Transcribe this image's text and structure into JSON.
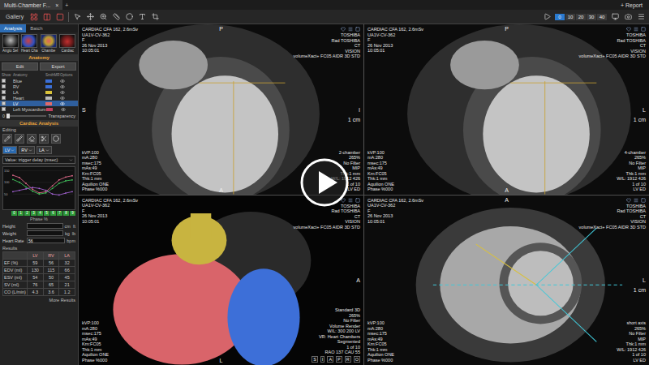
{
  "title_bar": {
    "tab": "Multi-Chamber F...",
    "close": "×",
    "add": "+",
    "report": "+ Report"
  },
  "toolbar": {
    "gallery": "Gallery",
    "frames": [
      {
        "label": "0",
        "selected": true
      },
      {
        "label": "10",
        "selected": false
      },
      {
        "label": "20",
        "selected": false
      },
      {
        "label": "30",
        "selected": false
      },
      {
        "label": "40",
        "selected": false
      }
    ]
  },
  "left_panel": {
    "tabs": [
      {
        "label": "Analysis",
        "selected": true
      },
      {
        "label": "Batch",
        "selected": false
      }
    ],
    "thumbnails": [
      {
        "label": "Angio Sel",
        "kind": "angio"
      },
      {
        "label": "Heart Cha",
        "kind": "heart"
      },
      {
        "label": "Chambe",
        "kind": "chamber"
      },
      {
        "label": "Cardiac",
        "kind": "cardiac"
      }
    ],
    "anatomy": {
      "title": "Anatomy",
      "buttons": [
        "Edit",
        "Export"
      ],
      "columns": [
        "Show",
        "Anatomy",
        "SmthMR",
        "Options"
      ],
      "rows": [
        {
          "name": "Blue",
          "show": true,
          "selected": false,
          "color": "#3b6fd6"
        },
        {
          "name": "RV",
          "show": true,
          "selected": false,
          "color": "#3b6fd6"
        },
        {
          "name": "LA",
          "show": true,
          "selected": false,
          "color": "#d9c23a"
        },
        {
          "name": "Heart",
          "show": true,
          "selected": false,
          "color": "#bbbbbb"
        },
        {
          "name": "LV",
          "show": true,
          "selected": true,
          "color": "#e06a6a"
        },
        {
          "name": "Left Myocardium",
          "show": true,
          "selected": false,
          "color": "#c04060"
        }
      ]
    },
    "transparency": {
      "value": "0",
      "label": "Transparency",
      "level": 0.03
    },
    "cardiac": {
      "title": "Cardiac Analysis",
      "editing": "Editing",
      "chambers": [
        {
          "label": "LV",
          "selected": true
        },
        {
          "label": "RV",
          "selected": false
        },
        {
          "label": "LA",
          "selected": false
        }
      ],
      "value_label": "Value: trigger delay (msec)",
      "chart": {
        "y_ticks": [
          "150",
          "100",
          "50"
        ],
        "series": [
          {
            "color": "#e06a8a",
            "values": [
              130,
              120,
              95,
              70,
              55,
              60,
              85,
              110,
              122,
              128
            ]
          },
          {
            "color": "#3fbf5a",
            "values": [
              112,
              100,
              80,
              62,
              50,
              55,
              74,
              95,
              106,
              110
            ]
          },
          {
            "color": "#a060d0",
            "values": [
              60,
              66,
              72,
              78,
              74,
              66,
              50,
              46,
              54,
              60
            ]
          }
        ],
        "phases": [
          "0",
          "1",
          "2",
          "3",
          "4",
          "5",
          "6",
          "7",
          "8",
          "9"
        ],
        "x_label": "Phase %"
      },
      "fields": [
        {
          "label": "Height",
          "value": "",
          "units": [
            "cm",
            "ft"
          ]
        },
        {
          "label": "Weight",
          "value": "",
          "units": [
            "kg",
            "lb"
          ]
        },
        {
          "label": "Heart Rate",
          "value": "56",
          "units": [
            "bpm"
          ]
        }
      ],
      "results": {
        "title": "Results",
        "columns": [
          "LV",
          "RV",
          "LA"
        ],
        "rows": [
          {
            "label": "EF (%)",
            "values": [
              "59",
              "56",
              "32"
            ]
          },
          {
            "label": "EDV (ml)",
            "values": [
              "130",
              "115",
              "66"
            ]
          },
          {
            "label": "ESV (ml)",
            "values": [
              "54",
              "50",
              "45"
            ]
          },
          {
            "label": "SV (ml)",
            "values": [
              "76",
              "65",
              "21"
            ]
          },
          {
            "label": "CO (L/min)",
            "values": [
              "4.3",
              "3.6",
              "1.2"
            ]
          }
        ],
        "more": "More Results"
      }
    }
  },
  "viewports": [
    {
      "kind": "two-chamber",
      "patient": [
        "CARDIAC CFA 162, 2.6mSv",
        "UA1V-CV-362",
        "F",
        "26 Nov 2013",
        "10:05:01"
      ],
      "vendor": [
        "TOSHIBA",
        "Rad TOSHIBA",
        "CT",
        "VISION",
        "volumeXact+ FC05 AIDR 3D STD"
      ],
      "tech": [
        "kVP:100",
        "mA:280",
        "msec:175",
        "mAs:49",
        "Krn:FC05",
        "Thk:1 mm",
        "Aquilion ONE",
        "Phase %000"
      ],
      "info": [
        "2-chamber",
        "265%",
        "No Filter",
        "MIP",
        "Thk:1 mm",
        "W/L: 1912 426",
        "1 of 10",
        "LV ED"
      ],
      "letters": [],
      "markers": [
        {
          "text": "P",
          "kind": "top"
        },
        {
          "text": "S",
          "kind": "left"
        },
        {
          "text": "I",
          "kind": "right"
        },
        {
          "text": "A",
          "kind": "bottom"
        },
        {
          "text": "1 cm",
          "kind": "scale"
        }
      ]
    },
    {
      "kind": "four-chamber",
      "patient": [
        "CARDIAC CFA 162, 2.6mSv",
        "UA1V-CV-362",
        "F",
        "26 Nov 2013",
        "10:05:01"
      ],
      "vendor": [
        "TOSHIBA",
        "Rad TOSHIBA",
        "CT",
        "VISION",
        "volumeXact+ FC05 AIDR 3D STD"
      ],
      "tech": [
        "kVP:100",
        "mA:280",
        "msec:175",
        "mAs:49",
        "Krn:FC05",
        "Thk:1 mm",
        "Aquilion ONE",
        "Phase %000"
      ],
      "info": [
        "4-chamber",
        "265%",
        "No Filter",
        "MIP",
        "Thk:1 mm",
        "W/L: 1912 426",
        "1 of 10",
        "LV ED"
      ],
      "letters": [],
      "markers": [
        {
          "text": "P",
          "kind": "top"
        },
        {
          "text": "L",
          "kind": "right"
        },
        {
          "text": "A",
          "kind": "bottom"
        },
        {
          "text": "1 cm",
          "kind": "scale"
        }
      ]
    },
    {
      "kind": "render",
      "patient": [
        "CARDIAC CFA 162, 2.6mSv",
        "UA1V-CV-362",
        "F",
        "26 Nov 2013",
        "10:05:01"
      ],
      "vendor": [
        "TOSHIBA",
        "Rad TOSHIBA",
        "CT",
        "VISION",
        "volumeXact+ FC05 AIDR 3D STD"
      ],
      "tech": [
        "kVP:100",
        "mA:280",
        "msec:175",
        "mAs:49",
        "Krn:FC05",
        "Thk:1 mm",
        "Aquilion ONE",
        "Phase %000"
      ],
      "info": [
        "Standard 3D",
        "265%",
        "No Filter",
        "Volume Render",
        "W/L: 300 200 LV",
        "VR: Heart Chambers",
        "Segmented",
        "1 of 10",
        "RAO 137  CAU 55"
      ],
      "letters": [
        "S",
        "I",
        "A",
        "P",
        "R",
        "O"
      ],
      "markers": [
        {
          "text": "A",
          "kind": "right"
        },
        {
          "text": "L",
          "kind": "bottom"
        }
      ]
    },
    {
      "kind": "short-axis",
      "patient": [
        "CARDIAC CFA 162, 2.6mSv",
        "UA1V-CV-362",
        "F",
        "26 Nov 2013",
        "10:05:01"
      ],
      "vendor": [
        "TOSHIBA",
        "Rad TOSHIBA",
        "CT",
        "VISION",
        "volumeXact+ FC05 AIDR 3D STD"
      ],
      "tech": [
        "kVP:100",
        "mA:280",
        "msec:175",
        "mAs:49",
        "Krn:FC05",
        "Thk:1 mm",
        "Aquilion ONE",
        "Phase %000"
      ],
      "info": [
        "short axis",
        "265%",
        "No Filter",
        "MIP",
        "Thk:1 mm",
        "W/L: 1912 426",
        "1 of 10",
        "LV ED"
      ],
      "letters": [],
      "markers": [
        {
          "text": "A",
          "kind": "top"
        },
        {
          "text": "L",
          "kind": "right"
        },
        {
          "text": "1 cm",
          "kind": "scale"
        }
      ]
    }
  ]
}
